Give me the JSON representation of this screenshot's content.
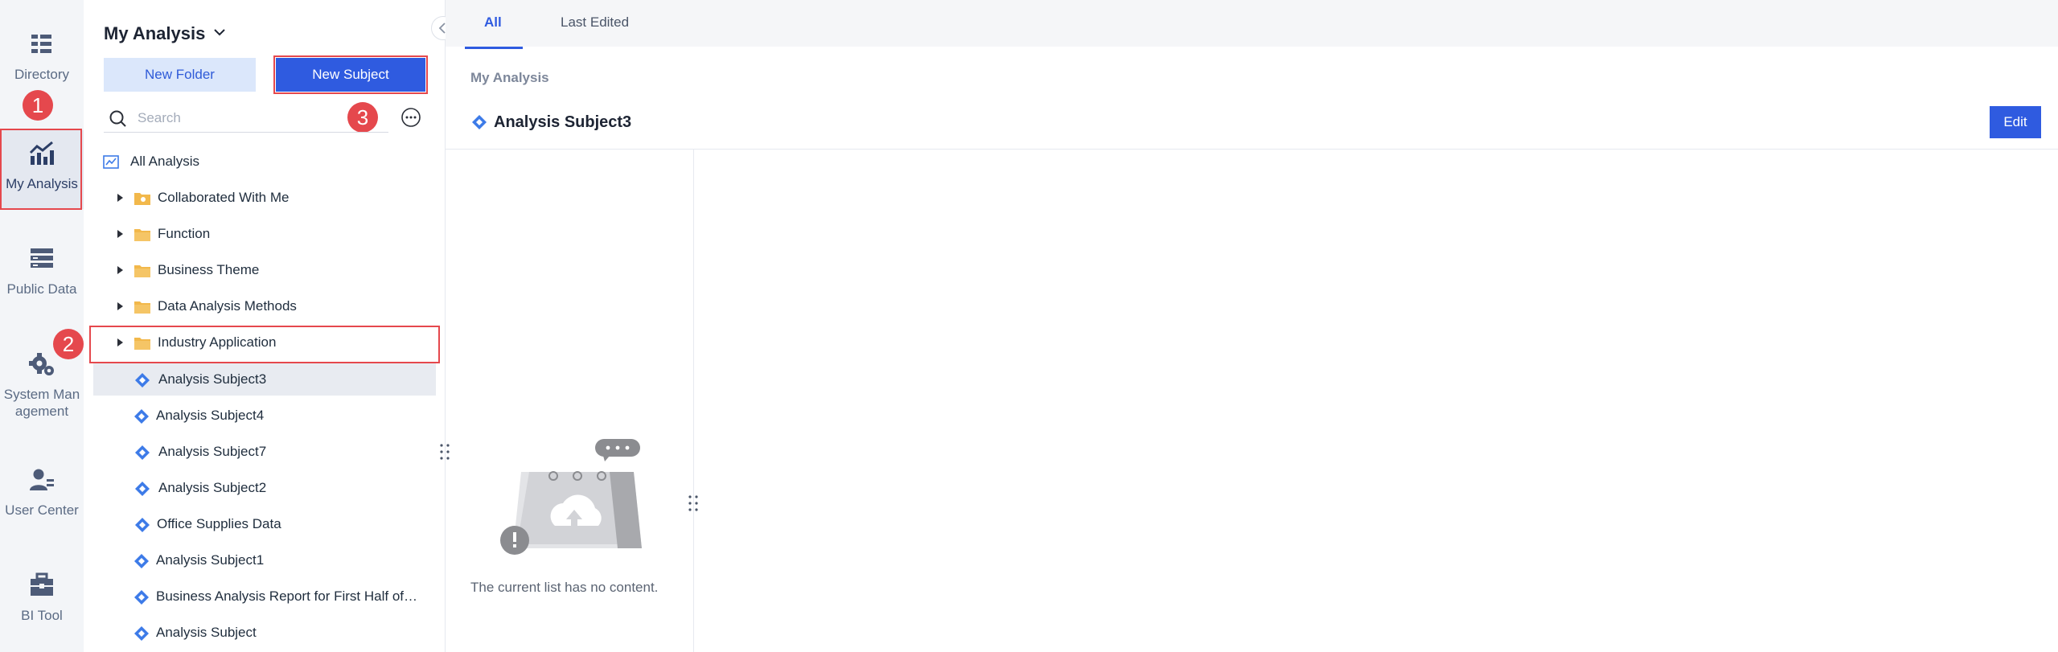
{
  "rail": {
    "items": [
      {
        "label": "Directory",
        "icon": "directory-icon"
      },
      {
        "label": "My Analysis",
        "icon": "analysis-chart-icon"
      },
      {
        "label": "Public Data",
        "icon": "public-data-icon"
      },
      {
        "label": "System Man agement",
        "line1": "System Man",
        "line2": "agement",
        "icon": "system-gear-icon"
      },
      {
        "label": "User Center",
        "icon": "user-center-icon"
      },
      {
        "label": "BI Tool",
        "icon": "toolbox-icon"
      }
    ]
  },
  "annotations": {
    "b1": "1",
    "b2": "2",
    "b3": "3"
  },
  "panel": {
    "title": "My Analysis",
    "new_folder": "New Folder",
    "new_subject": "New Subject",
    "search_placeholder": "Search",
    "tree": [
      {
        "label": "All Analysis",
        "type": "root"
      },
      {
        "label": "Collaborated With Me",
        "type": "folder-shared"
      },
      {
        "label": "Function",
        "type": "folder"
      },
      {
        "label": "Business Theme",
        "type": "folder"
      },
      {
        "label": "Data Analysis Methods",
        "type": "folder"
      },
      {
        "label": "Industry Application",
        "type": "folder"
      },
      {
        "label": "Analysis Subject3",
        "type": "subject",
        "selected": true
      },
      {
        "label": "Analysis Subject4",
        "type": "subject"
      },
      {
        "label": "Analysis Subject7",
        "type": "subject"
      },
      {
        "label": "Analysis Subject2",
        "type": "subject"
      },
      {
        "label": "Office Supplies Data",
        "type": "subject"
      },
      {
        "label": "Analysis Subject1",
        "type": "subject"
      },
      {
        "label": "Business Analysis Report for First Half of…",
        "type": "subject"
      },
      {
        "label": "Analysis Subject",
        "type": "subject"
      }
    ]
  },
  "main": {
    "tabs": [
      "All",
      "Last Edited"
    ],
    "breadcrumb": "My Analysis",
    "subject_title": "Analysis Subject3",
    "edit": "Edit",
    "empty_text": "The current list has no content."
  },
  "colors": {
    "accent": "#2f5be0",
    "annotation": "#e5484d",
    "folder": "#f2b84b",
    "subject": "#3d7be8"
  }
}
